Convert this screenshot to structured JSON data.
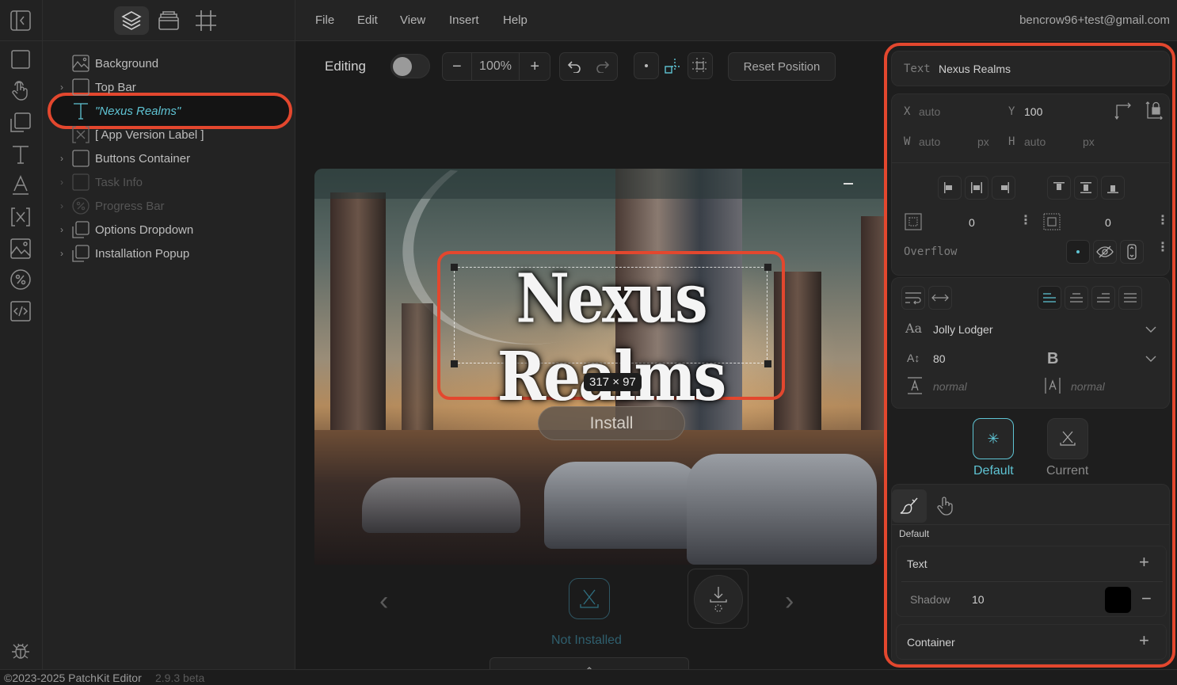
{
  "app": {
    "footer": {
      "copyright": "©2023-2025 PatchKit Editor",
      "version": "2.9.3 beta"
    }
  },
  "menubar": {
    "items": [
      "File",
      "Edit",
      "View",
      "Insert",
      "Help"
    ],
    "user_email": "bencrow96+test@gmail.com"
  },
  "rail": {
    "icons": [
      "collapse-panel-icon",
      "rectangle-tool-icon",
      "interaction-tool-icon",
      "component-tool-icon",
      "text-tool-icon",
      "font-tool-icon",
      "variable-tool-icon",
      "image-tool-icon",
      "progress-tool-icon",
      "code-tool-icon",
      "debug-icon"
    ]
  },
  "layers_panel": {
    "tabs": [
      "layers-tab",
      "assets-tab",
      "frame-tab"
    ],
    "active_tab": "layers-tab",
    "items": [
      {
        "label": "Background",
        "icon": "image-icon",
        "expandable": false,
        "state": "normal"
      },
      {
        "label": "Top Bar",
        "icon": "container-icon",
        "expandable": true,
        "state": "normal"
      },
      {
        "label": "\"Nexus Realms\"",
        "icon": "text-icon",
        "expandable": false,
        "state": "selected"
      },
      {
        "label": "[ App Version Label ]",
        "icon": "variable-icon",
        "expandable": false,
        "state": "normal"
      },
      {
        "label": "Buttons Container",
        "icon": "container-icon",
        "expandable": true,
        "state": "normal"
      },
      {
        "label": "Task Info",
        "icon": "container-icon",
        "expandable": true,
        "state": "hidden"
      },
      {
        "label": "Progress Bar",
        "icon": "progress-icon",
        "expandable": true,
        "state": "hidden"
      },
      {
        "label": "Options Dropdown",
        "icon": "component-icon",
        "expandable": true,
        "state": "normal"
      },
      {
        "label": "Installation Popup",
        "icon": "component-icon",
        "expandable": true,
        "state": "normal"
      }
    ]
  },
  "toolbar": {
    "editing_label": "Editing",
    "editing_enabled": false,
    "zoom_out": "−",
    "zoom_level": "100%",
    "zoom_in": "+",
    "undo": "↶",
    "redo": "↷",
    "reset_position_label": "Reset Position"
  },
  "preview": {
    "title_text": "Nexus Realms",
    "dimension_badge": "317 × 97",
    "install_button": "Install",
    "status_label": "Not Installed",
    "prev_arrow": "‹",
    "next_arrow": "›",
    "close_glyph": "×",
    "drawer_glyph": "⌃"
  },
  "properties": {
    "text_label": "Text",
    "text_value": "Nexus Realms",
    "x_label": "X",
    "x_value": "auto",
    "y_label": "Y",
    "y_value": "100",
    "w_label": "W",
    "w_value": "auto",
    "w_unit": "px",
    "h_label": "H",
    "h_value": "auto",
    "h_unit": "px",
    "padding_value": "0",
    "margin_value": "0",
    "overflow_label": "Overflow",
    "font_family": "Jolly Lodger",
    "font_size": "80",
    "font_weight_glyph": "B",
    "line_height": "normal",
    "letter_spacing": "normal",
    "text_align": "left",
    "states": [
      {
        "label": "Default",
        "active": true
      },
      {
        "label": "Current",
        "active": false
      }
    ],
    "style_mode_label": "Default",
    "sections": {
      "text": {
        "label": "Text"
      },
      "shadow": {
        "label": "Shadow",
        "value": "10",
        "color": "#000000"
      },
      "container": {
        "label": "Container"
      }
    }
  },
  "colors": {
    "accent": "#5fc4d4",
    "highlight": "#e3472e",
    "status_not_installed": "#2f5f6e"
  }
}
